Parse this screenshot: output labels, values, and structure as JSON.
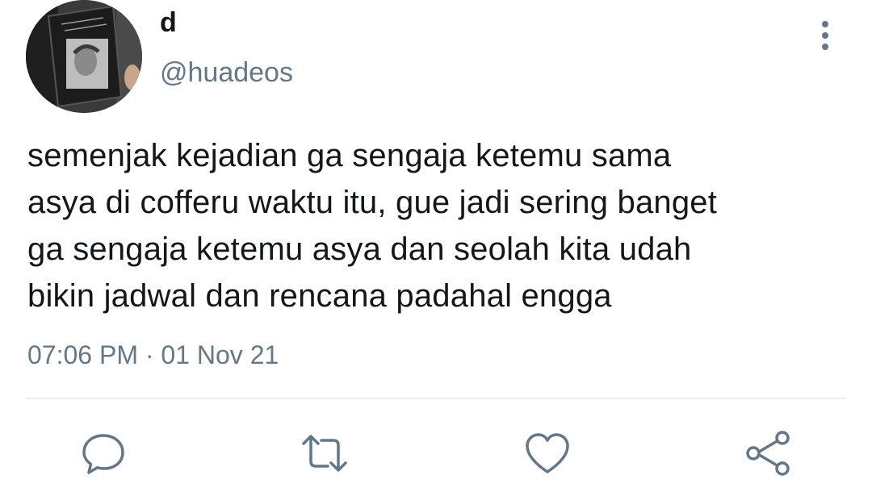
{
  "author": {
    "display_name": "d",
    "handle": "@huadeos",
    "avatar_icon": "avatar-book-photo"
  },
  "tweet": {
    "lines": [
      "semenjak kejadian ga sengaja ketemu sama",
      "asya di cofferu waktu itu, gue jadi sering banget",
      "ga sengaja ketemu asya dan seolah kita udah",
      "bikin jadwal dan rencana padahal engga"
    ],
    "timestamp": "07:06 PM · 01 Nov 21"
  },
  "actions": {
    "reply_icon": "reply-icon",
    "retweet_icon": "retweet-icon",
    "like_icon": "heart-icon",
    "share_icon": "share-icon",
    "more_icon": "more-vertical-icon"
  },
  "colors": {
    "text": "#14171a",
    "secondary": "#657786",
    "icon": "#657786",
    "divider": "#e6ecf0"
  }
}
